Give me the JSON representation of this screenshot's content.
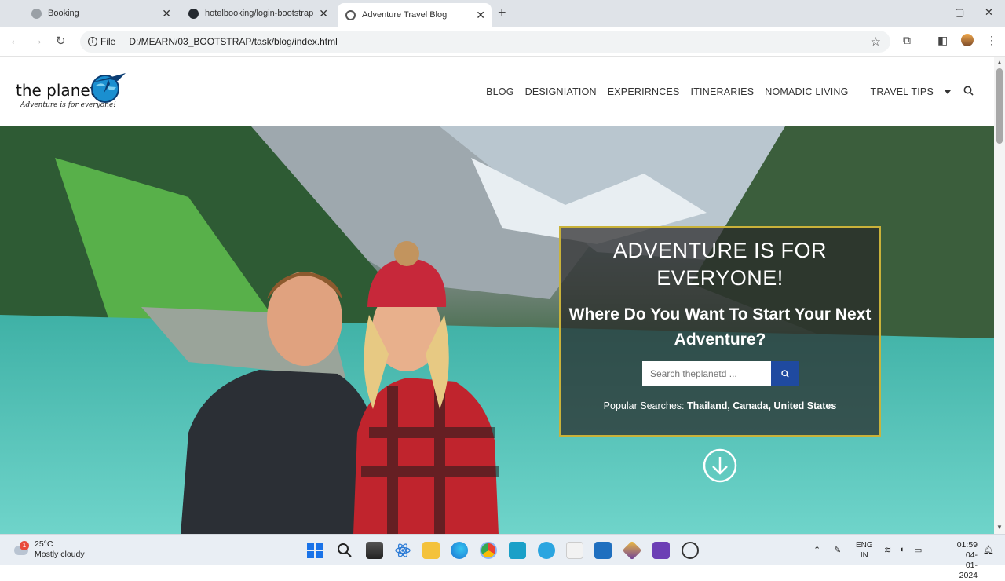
{
  "browser": {
    "tabs": [
      {
        "title": "Booking",
        "favicon_color": "#9aa0a6"
      },
      {
        "title": "hotelbooking/login-bootstrap",
        "favicon_color": "#24292f"
      },
      {
        "title": "Adventure Travel Blog",
        "favicon_color": "#555555"
      }
    ],
    "address": {
      "chip": "File",
      "url": "D:/MEARN/03_BOOTSTRAP/task/blog/index.html"
    }
  },
  "site": {
    "logo": {
      "name": "the planet",
      "tagline": "Adventure is for everyone!"
    },
    "nav": [
      "BLOG",
      "DESIGNIATION",
      "EXPERIRNCES",
      "ITINERARIES",
      "NOMADIC LIVING",
      "TRAVEL TIPS"
    ],
    "hero": {
      "title": "ADVENTURE IS FOR EVERYONE!",
      "subtitle": "Where Do You Want To Start Your Next Adventure?",
      "search_placeholder": "Search theplanetd ...",
      "popular_label": "Popular Searches:",
      "popular_items": "Thailand, Canada, United States"
    },
    "accent": "#1f4aa0",
    "box_border": "#c9b23a"
  },
  "taskbar": {
    "weather": {
      "temp": "25°C",
      "desc": "Mostly cloudy",
      "badge": "1"
    },
    "lang": {
      "line1": "ENG",
      "line2": "IN"
    },
    "clock": {
      "time": "01:59",
      "date": "04-01-2024"
    }
  }
}
